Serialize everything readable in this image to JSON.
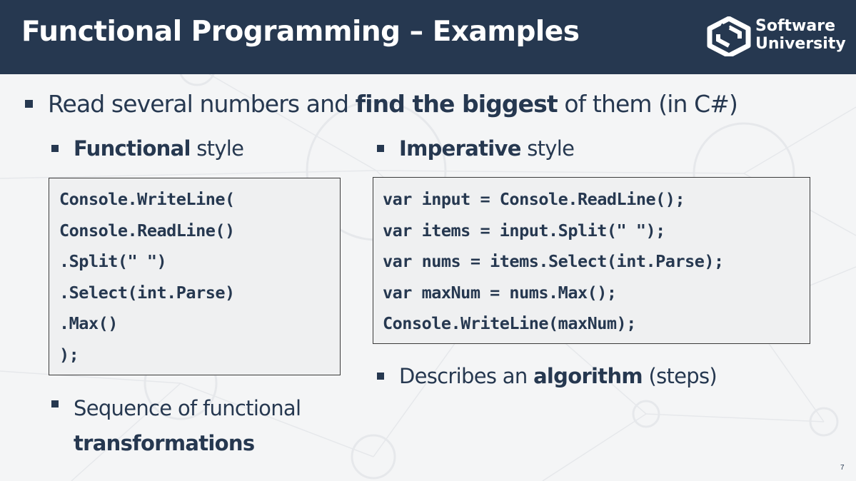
{
  "header": {
    "title": "Functional Programming – Examples",
    "logo": {
      "line1": "Software",
      "line2": "University",
      "icon": "softuni-logo-icon"
    }
  },
  "main": {
    "intro": {
      "text_pre": "Read several numbers and ",
      "text_bold": "find the biggest",
      "text_post": " of them (in C#)"
    },
    "functional": {
      "heading_bold": "Functional",
      "heading_rest": " style",
      "code": [
        "Console.WriteLine(",
        "  Console.ReadLine()",
        "    .Split(\" \")",
        "    .Select(int.Parse)",
        "    .Max()",
        ");"
      ],
      "note_line1": "Sequence of functional",
      "note_line2_bold": "transformations"
    },
    "imperative": {
      "heading_bold": "Imperative",
      "heading_rest": " style",
      "code": [
        "var input = Console.ReadLine();",
        "var items = input.Split(\" \");",
        "var nums = items.Select(int.Parse);",
        "var maxNum = nums.Max();",
        "Console.WriteLine(maxNum);"
      ],
      "note_pre": "Describes an ",
      "note_bold": "algorithm",
      "note_post": " (steps)"
    }
  },
  "footer": {
    "page_number": "7"
  },
  "colors": {
    "header_bg": "#263850",
    "text": "#263850",
    "code_bg": "#eff0f1",
    "background": "#f4f5f6"
  }
}
